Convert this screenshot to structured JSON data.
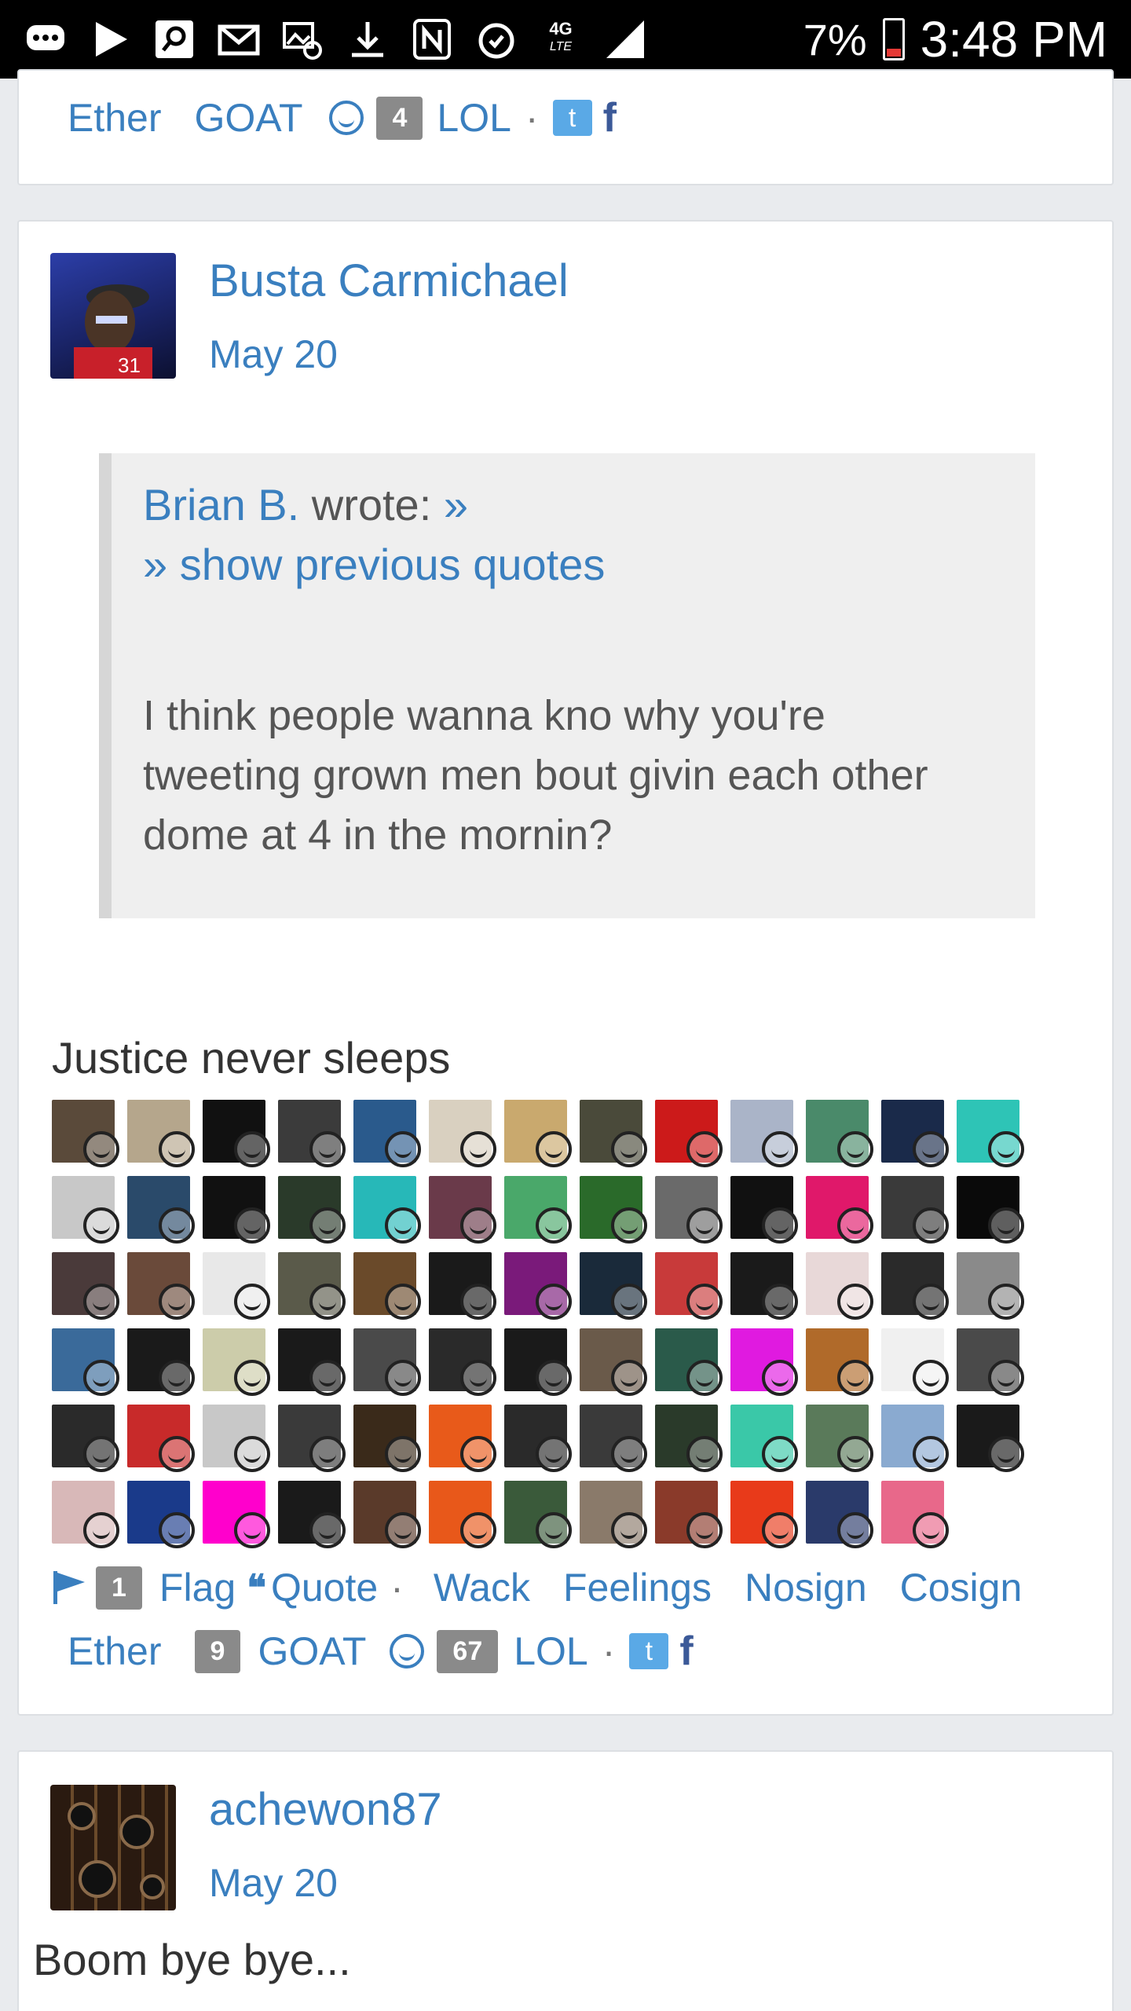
{
  "status_bar": {
    "battery": "7%",
    "time": "3:48 PM",
    "icons": [
      "chat-bubble-icon",
      "play-store-icon",
      "search-app-icon",
      "mail-icon",
      "gallery-mail-icon",
      "download-icon",
      "nfc-icon",
      "alarm-icon",
      "4g-lte-icon",
      "signal-icon",
      "battery-icon"
    ]
  },
  "prev_post_actions": {
    "ether": "Ether",
    "goat": "GOAT",
    "lol_count": "4",
    "lol": "LOL",
    "dot": "·",
    "twitter": "t",
    "facebook": "f"
  },
  "post": {
    "username": "Busta Carmichael",
    "date": "May 20",
    "quote": {
      "author": "Brian B.",
      "wrote": "wrote:",
      "jump": "»",
      "show_previous": "» show previous quotes",
      "body": "I think people wanna kno why you're tweeting grown men bout givin each other dome at 4 in the mornin?"
    },
    "signature": "Justice never sleeps",
    "tile_colors": [
      "#5a4a3a",
      "#b5a68c",
      "#111111",
      "#3b3b3b",
      "#2a5a8c",
      "#d9d0c0",
      "#c9a96e",
      "#4a4a3a",
      "#cc1a1a",
      "#aab4c8",
      "#4a8a6a",
      "#1a2a4a",
      "#2ec4b6",
      "#c8c8c8",
      "#2a4a6a",
      "#111111",
      "#2a3a2a",
      "#27b8b8",
      "#6a3a4a",
      "#4aa86a",
      "#2a6a2a",
      "#6a6a6a",
      "#111111",
      "#e0186a",
      "#3a3a3a",
      "#0a0a0a",
      "#4a3a3a",
      "#6a4a3a",
      "#e8e8e8",
      "#5a5a4a",
      "#6a4a2a",
      "#1a1a1a",
      "#7a1a7a",
      "#1a2a3a",
      "#c83a3a",
      "#1a1a1a",
      "#e8d8d8",
      "#2a2a2a",
      "#8a8a8a",
      "#3a6a9a",
      "#1a1a1a",
      "#ccccaa",
      "#1a1a1a",
      "#4a4a4a",
      "#2a2a2a",
      "#1a1a1a",
      "#6a5a4a",
      "#2a5a4a",
      "#e01ae0",
      "#b06a2a",
      "#f0f0f0",
      "#4a4a4a",
      "#2a2a2a",
      "#c82a2a",
      "#c8c8c8",
      "#3a3a3a",
      "#3a2a1a",
      "#e85a1a",
      "#2a2a2a",
      "#3a3a3a",
      "#2a3a2a",
      "#3ac8a8",
      "#5a7a5a",
      "#8aaad0",
      "#1a1a1a",
      "#d8b8b8",
      "#1a3a8a",
      "#ff00cc",
      "#1a1a1a",
      "#5a3a2a",
      "#e8581a",
      "#3a5a3a",
      "#8a7a6a",
      "#8a3a2a",
      "#e83a1a",
      "#2a3a6a",
      "#e8688a"
    ]
  },
  "post_actions": {
    "flag_count": "1",
    "flag": "Flag",
    "quote": "Quote",
    "dot": "·",
    "wack": "Wack",
    "feelings": "Feelings",
    "nosign": "Nosign",
    "cosign": "Cosign",
    "ether": "Ether",
    "goat_count": "9",
    "goat": "GOAT",
    "lol_count": "67",
    "lol": "LOL",
    "twitter": "t",
    "facebook": "f"
  },
  "next_post": {
    "username": "achewon87",
    "date": "May 20",
    "body": "Boom bye bye..."
  }
}
